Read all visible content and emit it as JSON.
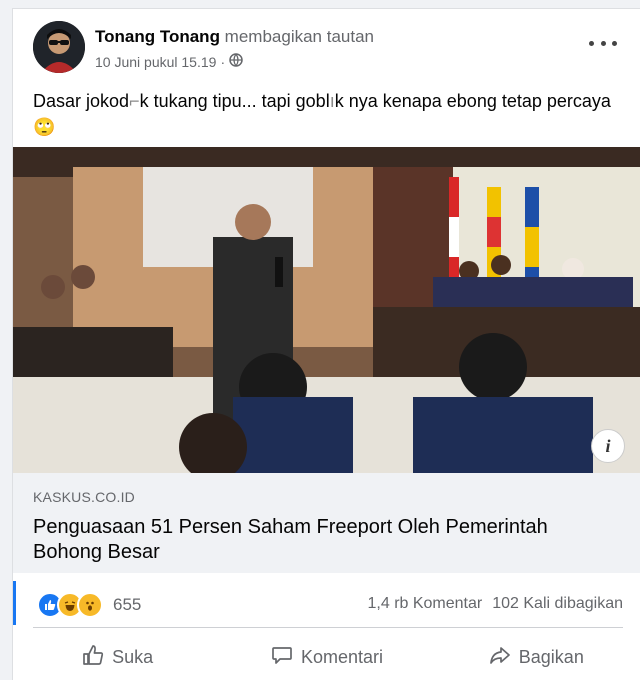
{
  "post": {
    "author": "Tonang Tonang",
    "action_text": " membagikan tautan",
    "timestamp": "10 Juni pukul 15.19",
    "separator": "·",
    "privacy_icon": "globe-icon",
    "more_icon": "more-horizontal-icon",
    "text": "Dasar jokod",
    "text_cont": "k tukang tipu... tapi gobl",
    "text_cont2": "k nya kenapa ebong tetap percaya",
    "emoji": "🙄"
  },
  "link": {
    "domain": "KASKUS.CO.ID",
    "title": "Penguasaan 51 Persen Saham Freeport Oleh Pemerintah Bohong Besar",
    "info_icon": "i"
  },
  "stats": {
    "reaction_icons": [
      "like-icon",
      "haha-icon",
      "wow-icon"
    ],
    "reaction_count": "655",
    "comments": "1,4 rb Komentar",
    "shares": "102 Kali dibagikan"
  },
  "actions": {
    "like_label": "Suka",
    "comment_label": "Komentari",
    "share_label": "Bagikan"
  },
  "colors": {
    "accent": "#1877f2",
    "secondary_text": "#65676b",
    "link_meta_bg": "#f0f2f5"
  }
}
